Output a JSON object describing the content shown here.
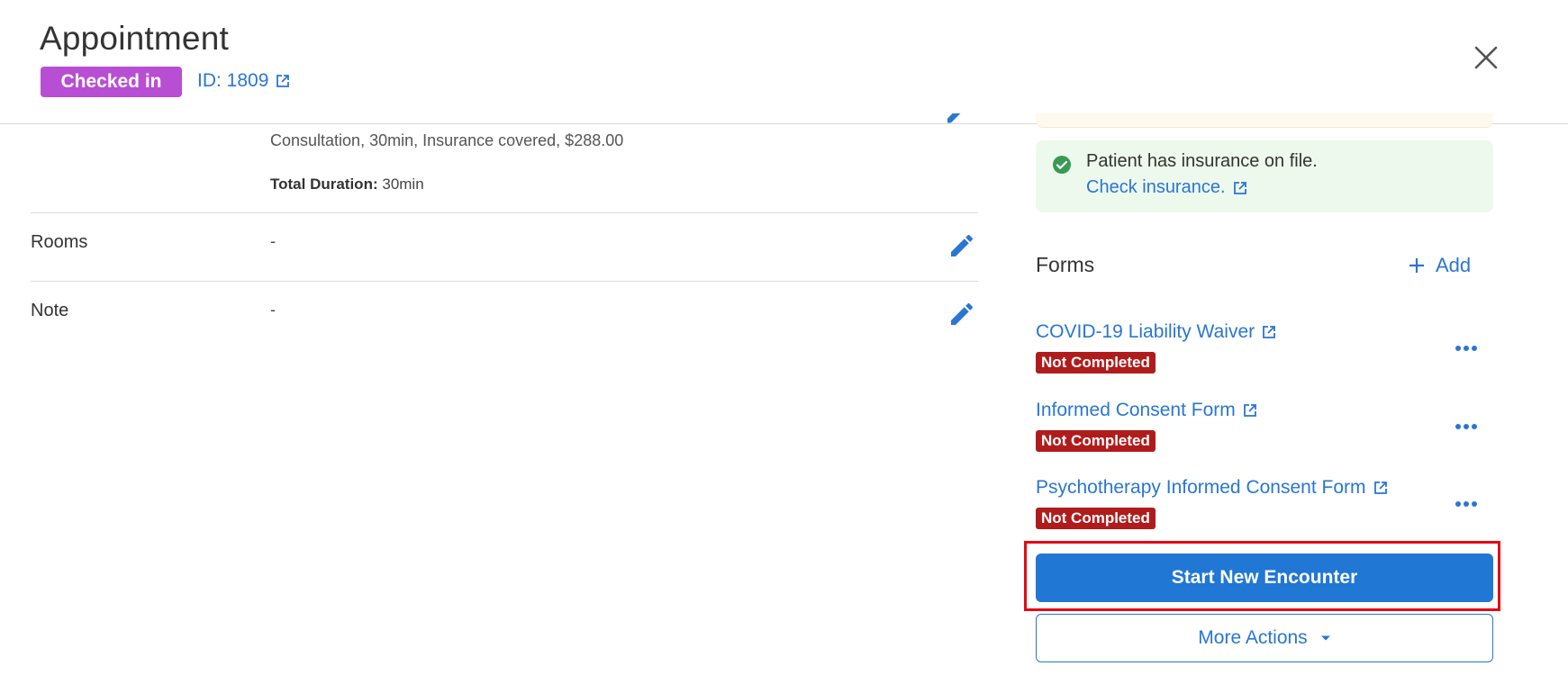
{
  "header": {
    "title": "Appointment",
    "status": "Checked in",
    "id_label": "ID: 1809"
  },
  "details": {
    "service": "Consultation, 30min, Insurance covered, $288.00",
    "total_duration_label": "Total Duration:",
    "total_duration_value": "30min",
    "rows": [
      {
        "label": "Rooms",
        "value": "-"
      },
      {
        "label": "Note",
        "value": "-"
      }
    ]
  },
  "insurance": {
    "message": "Patient has insurance on file.",
    "link": "Check insurance."
  },
  "forms": {
    "title": "Forms",
    "add_label": "Add",
    "items": [
      {
        "name": "COVID-19 Liability Waiver",
        "status": "Not Completed"
      },
      {
        "name": "Informed Consent Form",
        "status": "Not Completed"
      },
      {
        "name": "Psychotherapy Informed Consent Form",
        "status": "Not Completed"
      }
    ]
  },
  "actions": {
    "primary": "Start New Encounter",
    "secondary": "More Actions"
  },
  "colors": {
    "accent": "#2077d4",
    "status_purple": "#b84ed3",
    "badge_red": "#b01c1c",
    "success_bg": "#edf9ec",
    "highlight": "#e50914"
  },
  "icons": {
    "close": "close-icon",
    "external": "external-link-icon",
    "edit": "pencil-icon",
    "check": "check-circle-icon",
    "add": "plus-icon",
    "more": "more-horizontal-icon",
    "dropdown": "caret-down-icon"
  }
}
